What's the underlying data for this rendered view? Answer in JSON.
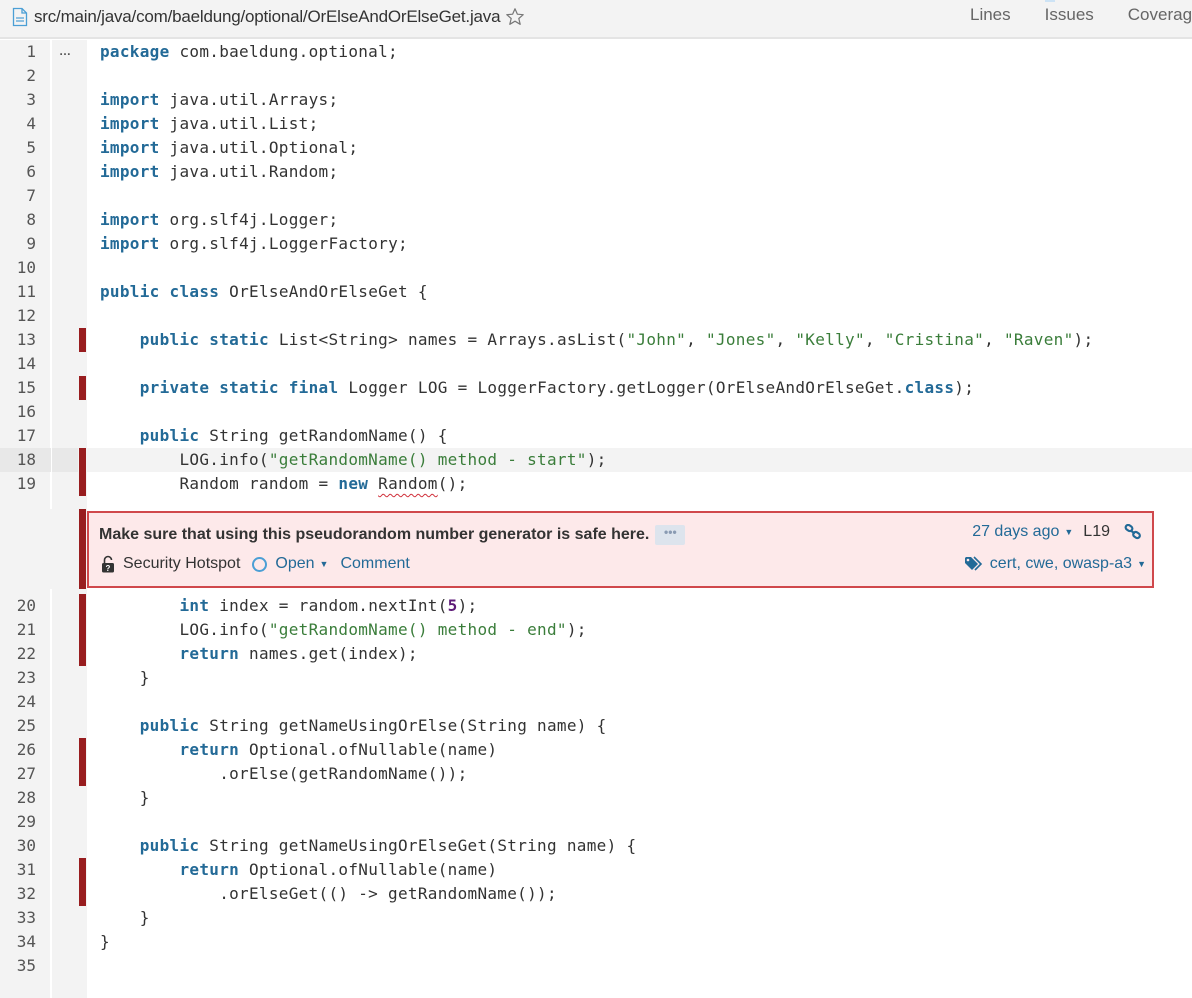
{
  "header": {
    "file_path": "src/main/java/com/baeldung/optional/OrElseAndOrElseGet.java",
    "tabs": [
      {
        "label": "Lines"
      },
      {
        "label": "Issues"
      },
      {
        "label": "Coverage"
      }
    ]
  },
  "colors": {
    "keyword": "#236a97",
    "string": "#3a7d3a",
    "number": "#5e1b78",
    "uncovered_bar": "#981d1f",
    "issue_border": "#d0484c",
    "issue_background": "#fde9ea",
    "link": "#236a97"
  },
  "source": {
    "highlighted_line": 18,
    "scm_expander_label": "…",
    "lines": [
      {
        "n": "1",
        "cov": false,
        "tokens": [
          [
            "k",
            "package"
          ],
          [
            "t",
            " com.baeldung.optional;"
          ]
        ]
      },
      {
        "n": "2",
        "cov": false,
        "tokens": []
      },
      {
        "n": "3",
        "cov": false,
        "tokens": [
          [
            "k",
            "import"
          ],
          [
            "t",
            " java.util.Arrays;"
          ]
        ]
      },
      {
        "n": "4",
        "cov": false,
        "tokens": [
          [
            "k",
            "import"
          ],
          [
            "t",
            " java.util.List;"
          ]
        ]
      },
      {
        "n": "5",
        "cov": false,
        "tokens": [
          [
            "k",
            "import"
          ],
          [
            "t",
            " java.util.Optional;"
          ]
        ]
      },
      {
        "n": "6",
        "cov": false,
        "tokens": [
          [
            "k",
            "import"
          ],
          [
            "t",
            " java.util.Random;"
          ]
        ]
      },
      {
        "n": "7",
        "cov": false,
        "tokens": []
      },
      {
        "n": "8",
        "cov": false,
        "tokens": [
          [
            "k",
            "import"
          ],
          [
            "t",
            " org.slf4j.Logger;"
          ]
        ]
      },
      {
        "n": "9",
        "cov": false,
        "tokens": [
          [
            "k",
            "import"
          ],
          [
            "t",
            " org.slf4j.LoggerFactory;"
          ]
        ]
      },
      {
        "n": "10",
        "cov": false,
        "tokens": []
      },
      {
        "n": "11",
        "cov": false,
        "tokens": [
          [
            "k",
            "public"
          ],
          [
            "t",
            " "
          ],
          [
            "k",
            "class"
          ],
          [
            "t",
            " OrElseAndOrElseGet {"
          ]
        ]
      },
      {
        "n": "12",
        "cov": false,
        "tokens": []
      },
      {
        "n": "13",
        "cov": true,
        "tokens": [
          [
            "t",
            "    "
          ],
          [
            "k",
            "public"
          ],
          [
            "t",
            " "
          ],
          [
            "k",
            "static"
          ],
          [
            "t",
            " List<String> names = Arrays.asList("
          ],
          [
            "s",
            "\"John\""
          ],
          [
            "t",
            ", "
          ],
          [
            "s",
            "\"Jones\""
          ],
          [
            "t",
            ", "
          ],
          [
            "s",
            "\"Kelly\""
          ],
          [
            "t",
            ", "
          ],
          [
            "s",
            "\"Cristina\""
          ],
          [
            "t",
            ", "
          ],
          [
            "s",
            "\"Raven\""
          ],
          [
            "t",
            ");"
          ]
        ]
      },
      {
        "n": "14",
        "cov": false,
        "tokens": []
      },
      {
        "n": "15",
        "cov": true,
        "tokens": [
          [
            "t",
            "    "
          ],
          [
            "k",
            "private"
          ],
          [
            "t",
            " "
          ],
          [
            "k",
            "static"
          ],
          [
            "t",
            " "
          ],
          [
            "k",
            "final"
          ],
          [
            "t",
            " Logger LOG = LoggerFactory.getLogger(OrElseAndOrElseGet."
          ],
          [
            "k",
            "class"
          ],
          [
            "t",
            ");"
          ]
        ]
      },
      {
        "n": "16",
        "cov": false,
        "tokens": []
      },
      {
        "n": "17",
        "cov": false,
        "tokens": [
          [
            "t",
            "    "
          ],
          [
            "k",
            "public"
          ],
          [
            "t",
            " String getRandomName() {"
          ]
        ]
      },
      {
        "n": "18",
        "cov": true,
        "tokens": [
          [
            "t",
            "        LOG.info("
          ],
          [
            "s",
            "\"getRandomName() method - start\""
          ],
          [
            "t",
            ");"
          ]
        ]
      },
      {
        "n": "19",
        "cov": true,
        "tokens": [
          [
            "t",
            "        Random random = "
          ],
          [
            "k",
            "new"
          ],
          [
            "t",
            " "
          ],
          [
            "e",
            "Random"
          ],
          [
            "t",
            "();"
          ]
        ]
      }
    ],
    "lines_after_issue": [
      {
        "n": "20",
        "cov": true,
        "tokens": [
          [
            "t",
            "        "
          ],
          [
            "k",
            "int"
          ],
          [
            "t",
            " index = random.nextInt("
          ],
          [
            "n",
            "5"
          ],
          [
            "t",
            ");"
          ]
        ]
      },
      {
        "n": "21",
        "cov": true,
        "tokens": [
          [
            "t",
            "        LOG.info("
          ],
          [
            "s",
            "\"getRandomName() method - end\""
          ],
          [
            "t",
            ");"
          ]
        ]
      },
      {
        "n": "22",
        "cov": true,
        "tokens": [
          [
            "t",
            "        "
          ],
          [
            "k",
            "return"
          ],
          [
            "t",
            " names.get(index);"
          ]
        ]
      },
      {
        "n": "23",
        "cov": false,
        "tokens": [
          [
            "t",
            "    }"
          ]
        ]
      },
      {
        "n": "24",
        "cov": false,
        "tokens": []
      },
      {
        "n": "25",
        "cov": false,
        "tokens": [
          [
            "t",
            "    "
          ],
          [
            "k",
            "public"
          ],
          [
            "t",
            " String getNameUsingOrElse(String name) {"
          ]
        ]
      },
      {
        "n": "26",
        "cov": true,
        "tokens": [
          [
            "t",
            "        "
          ],
          [
            "k",
            "return"
          ],
          [
            "t",
            " Optional.ofNullable(name)"
          ]
        ]
      },
      {
        "n": "27",
        "cov": true,
        "tokens": [
          [
            "t",
            "            .orElse(getRandomName());"
          ]
        ]
      },
      {
        "n": "28",
        "cov": false,
        "tokens": [
          [
            "t",
            "    }"
          ]
        ]
      },
      {
        "n": "29",
        "cov": false,
        "tokens": []
      },
      {
        "n": "30",
        "cov": false,
        "tokens": [
          [
            "t",
            "    "
          ],
          [
            "k",
            "public"
          ],
          [
            "t",
            " String getNameUsingOrElseGet(String name) {"
          ]
        ]
      },
      {
        "n": "31",
        "cov": true,
        "tokens": [
          [
            "t",
            "        "
          ],
          [
            "k",
            "return"
          ],
          [
            "t",
            " Optional.ofNullable(name)"
          ]
        ]
      },
      {
        "n": "32",
        "cov": true,
        "tokens": [
          [
            "t",
            "            .orElseGet(() -> getRandomName());"
          ]
        ]
      },
      {
        "n": "33",
        "cov": false,
        "tokens": [
          [
            "t",
            "    }"
          ]
        ]
      },
      {
        "n": "34",
        "cov": false,
        "tokens": [
          [
            "t",
            "}"
          ]
        ]
      },
      {
        "n": "35",
        "cov": false,
        "tokens": []
      }
    ]
  },
  "issue": {
    "message": "Make sure that using this pseudorandom number generator is safe here.",
    "more_label": "•••",
    "type": "Security Hotspot",
    "status": "Open",
    "comment_label": "Comment",
    "date": "27 days ago",
    "line_ref": "L19",
    "tags": "cert, cwe, owasp-a3",
    "caret": "▼"
  }
}
